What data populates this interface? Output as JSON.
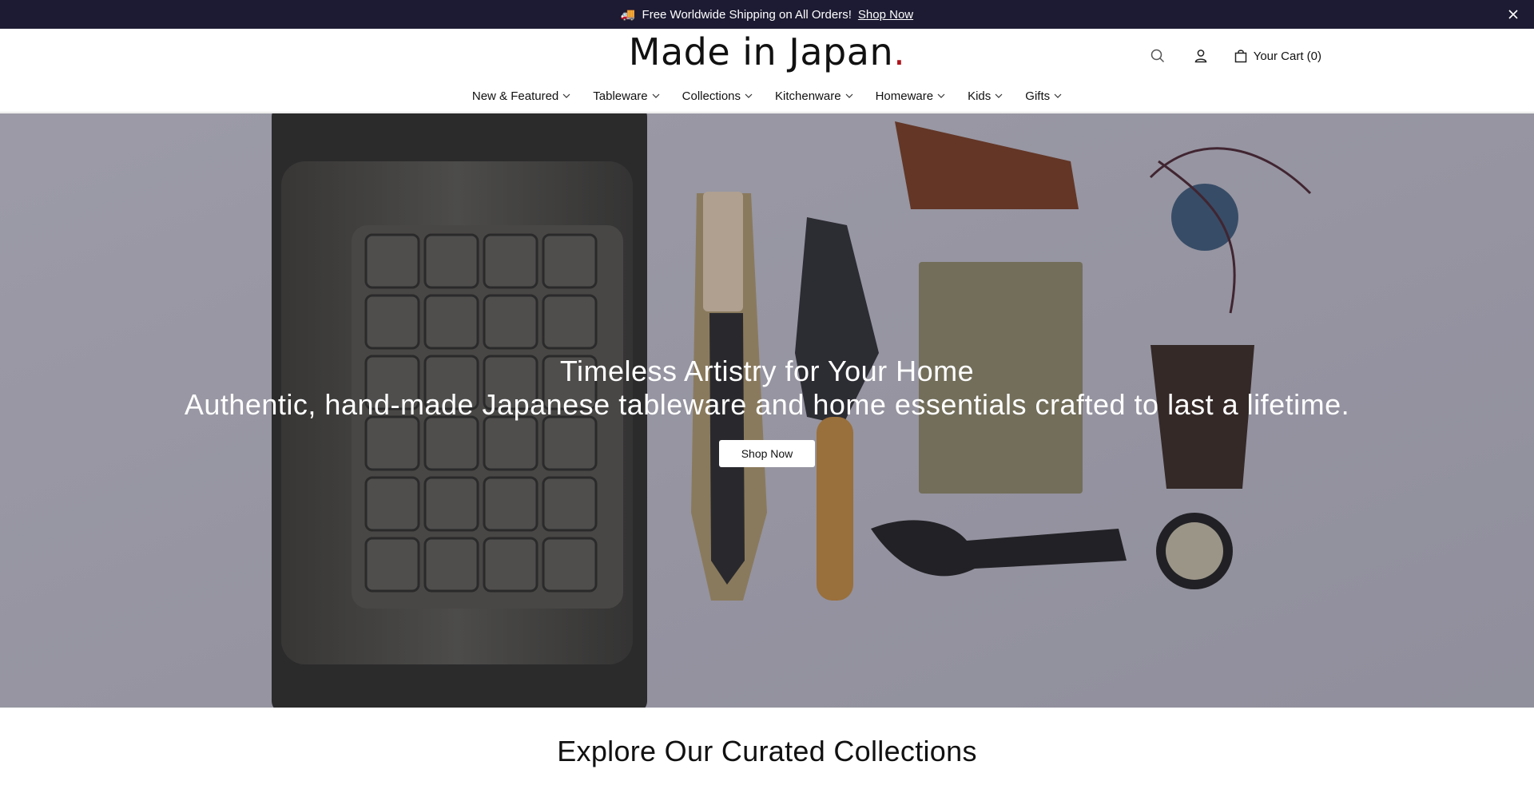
{
  "announcement": {
    "emoji": "🚚",
    "text": "Free Worldwide Shipping on All Orders!",
    "link": "Shop Now"
  },
  "header": {
    "logo": "Made in Japan",
    "logo_dot": ".",
    "cart_label": "Your Cart (0)"
  },
  "nav": {
    "items": [
      {
        "label": "New & Featured"
      },
      {
        "label": "Tableware"
      },
      {
        "label": "Collections"
      },
      {
        "label": "Kitchenware"
      },
      {
        "label": "Homeware"
      },
      {
        "label": "Kids"
      },
      {
        "label": "Gifts"
      }
    ]
  },
  "hero": {
    "title": "Timeless Artistry for Your Home",
    "subtitle": "Authentic, hand-made Japanese tableware and home essentials crafted to last a lifetime.",
    "button": "Shop Now"
  },
  "collections": {
    "title": "Explore Our Curated Collections"
  },
  "colors": {
    "announcement_bg": "#1c1b33",
    "logo_dot": "#b0141b"
  }
}
